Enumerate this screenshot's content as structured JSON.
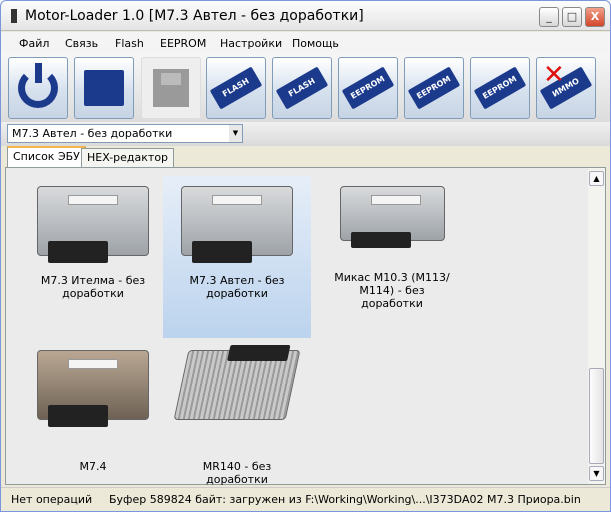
{
  "window": {
    "title": "Motor-Loader 1.0 [M7.3 Автел - без доработки]",
    "min": "_",
    "max": "□",
    "close": "X"
  },
  "menu": [
    "Файл",
    "Связь",
    "Flash",
    "EEPROM",
    "Настройки",
    "Помощь"
  ],
  "toolbar": {
    "chip_labels": [
      "FLASH",
      "FLASH",
      "EEPROM",
      "EEPROM",
      "EEPROM",
      "ИММО"
    ]
  },
  "combo": {
    "value": "M7.3 Автел - без доработки"
  },
  "tabs": [
    "Список ЭБУ",
    "HEX-редактор"
  ],
  "ecus": [
    {
      "label": "M7.3 Ителма - без доработки"
    },
    {
      "label": "M7.3 Автел - без доработки",
      "selected": true
    },
    {
      "label": "Микас М10.3 (М113/М114) - без доработки"
    },
    {
      "label": "M7.4"
    },
    {
      "label": "MR140 - без доработки"
    }
  ],
  "status": {
    "left": "Нет операций",
    "right": "Буфер 589824 байт: загружен из F:\\Working\\Working\\...\\I373DA02 M7.3 Приора.bin"
  }
}
